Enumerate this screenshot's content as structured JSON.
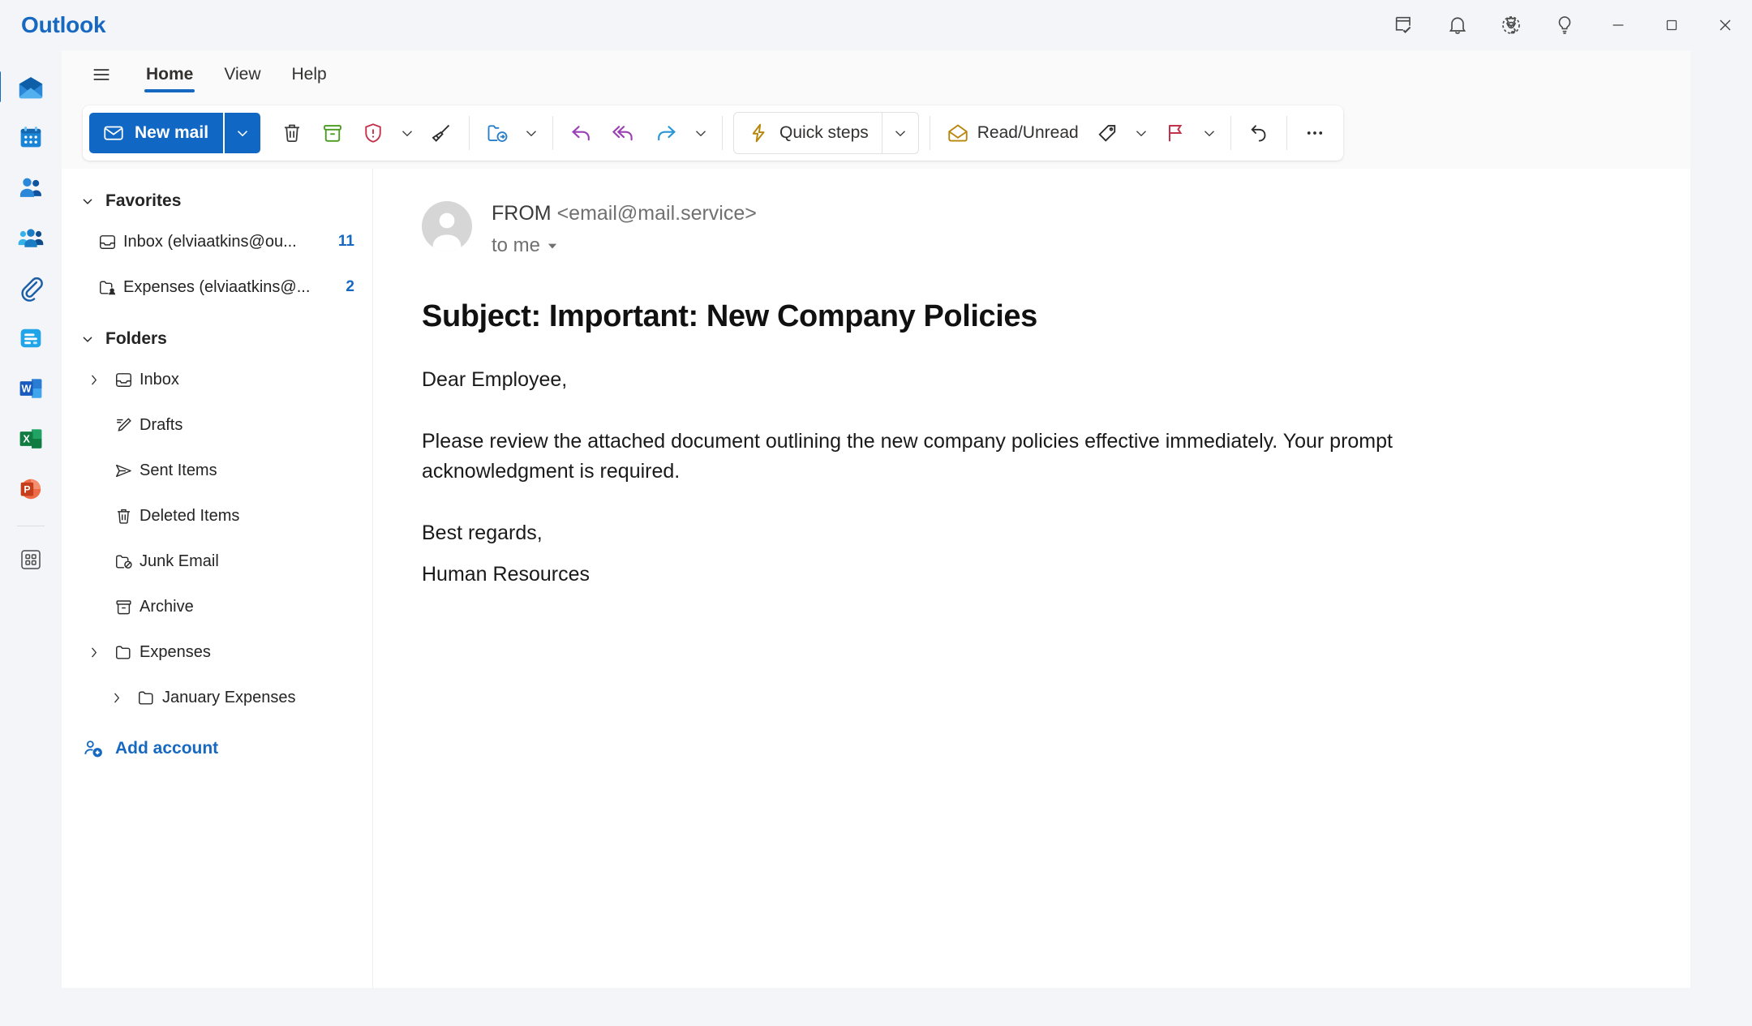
{
  "app": {
    "brand": "Outlook"
  },
  "titlebar": {
    "actions": [
      {
        "name": "new-note-icon",
        "label": "New note"
      },
      {
        "name": "notifications-bell-icon",
        "label": "Notifications"
      },
      {
        "name": "settings-gear-icon",
        "label": "Settings"
      },
      {
        "name": "tips-lightbulb-icon",
        "label": "Tips"
      }
    ],
    "window_controls": [
      {
        "name": "minimize-button",
        "label": "Minimize"
      },
      {
        "name": "maximize-button",
        "label": "Maximize"
      },
      {
        "name": "close-button",
        "label": "Close"
      }
    ]
  },
  "rail": {
    "items": [
      {
        "name": "rail-item-mail",
        "label": "Mail",
        "active": true
      },
      {
        "name": "rail-item-calendar",
        "label": "Calendar",
        "active": false
      },
      {
        "name": "rail-item-people",
        "label": "People",
        "active": false
      },
      {
        "name": "rail-item-groups",
        "label": "Groups",
        "active": false
      },
      {
        "name": "rail-item-attachments",
        "label": "Attachments",
        "active": false
      },
      {
        "name": "rail-item-bookings",
        "label": "Bookings",
        "active": false
      },
      {
        "name": "rail-item-word",
        "label": "Word",
        "active": false
      },
      {
        "name": "rail-item-excel",
        "label": "Excel",
        "active": false
      },
      {
        "name": "rail-item-powerpoint",
        "label": "PowerPoint",
        "active": false
      },
      {
        "name": "rail-item-apps",
        "label": "Apps",
        "active": false
      }
    ]
  },
  "ribbon": {
    "tabs": [
      {
        "label": "Home",
        "active": true
      },
      {
        "label": "View",
        "active": false
      },
      {
        "label": "Help",
        "active": false
      }
    ],
    "new_mail_label": "New mail",
    "quick_steps_label": "Quick steps",
    "read_unread_label": "Read/Unread",
    "buttons": [
      {
        "name": "delete-button",
        "label": "Delete"
      },
      {
        "name": "archive-button",
        "label": "Archive"
      },
      {
        "name": "report-junk-button",
        "label": "Report"
      },
      {
        "name": "sweep-button",
        "label": "Sweep"
      },
      {
        "name": "move-to-button",
        "label": "Move to"
      },
      {
        "name": "reply-button",
        "label": "Reply"
      },
      {
        "name": "reply-all-button",
        "label": "Reply all"
      },
      {
        "name": "forward-button",
        "label": "Forward"
      },
      {
        "name": "tag-button",
        "label": "Tag"
      },
      {
        "name": "flag-button",
        "label": "Flag"
      },
      {
        "name": "undo-button",
        "label": "Undo"
      },
      {
        "name": "more-options-button",
        "label": "More options"
      }
    ]
  },
  "sidebar": {
    "favorites": {
      "title": "Favorites",
      "items": [
        {
          "label": "Inbox (elviaatkins@ou...",
          "count": "11",
          "icon": "inbox-icon",
          "name": "sidebar-item-favorite-inbox"
        },
        {
          "label": "Expenses (elviaatkins@...",
          "count": "2",
          "icon": "shared-folder-icon",
          "name": "sidebar-item-favorite-expenses"
        }
      ]
    },
    "folders": {
      "title": "Folders",
      "items": [
        {
          "label": "Inbox",
          "count": "",
          "icon": "inbox-icon",
          "indent": 0,
          "twisty": true,
          "name": "sidebar-item-inbox"
        },
        {
          "label": "Drafts",
          "count": "",
          "icon": "drafts-pencil-icon",
          "indent": 0,
          "twisty": false,
          "name": "sidebar-item-drafts"
        },
        {
          "label": "Sent Items",
          "count": "",
          "icon": "sent-plane-icon",
          "indent": 0,
          "twisty": false,
          "name": "sidebar-item-sent-items"
        },
        {
          "label": "Deleted Items",
          "count": "",
          "icon": "trash-icon",
          "indent": 0,
          "twisty": false,
          "name": "sidebar-item-deleted-items"
        },
        {
          "label": "Junk Email",
          "count": "",
          "icon": "junk-folder-icon",
          "indent": 0,
          "twisty": false,
          "name": "sidebar-item-junk-email"
        },
        {
          "label": "Archive",
          "count": "",
          "icon": "archive-box-icon",
          "indent": 0,
          "twisty": false,
          "name": "sidebar-item-archive"
        },
        {
          "label": "Expenses",
          "count": "",
          "icon": "folder-icon",
          "indent": 0,
          "twisty": true,
          "name": "sidebar-item-expenses"
        },
        {
          "label": "January Expenses",
          "count": "",
          "icon": "folder-icon",
          "indent": 1,
          "twisty": true,
          "name": "sidebar-item-january-expenses"
        }
      ]
    },
    "add_account_label": "Add account"
  },
  "message": {
    "from_label": "FROM",
    "from_address": "<email@mail.service>",
    "to_label": "to me",
    "subject": "Subject: Important: New Company Policies",
    "greeting": "Dear Employee,",
    "paragraph": "Please review the attached document outlining the new company policies effective immediately. Your prompt acknowledgment is required.",
    "closing": "Best regards,",
    "signature": "Human Resources"
  },
  "colors": {
    "brand_blue": "#1668c1",
    "accent_button": "#1168c4",
    "archive_green": "#4a9c1f",
    "junk_red": "#c4314b",
    "reply_purple": "#9b3fb5",
    "forward_blue": "#2a95d5",
    "quick_steps_gold": "#b8860b",
    "flag_red": "#c4314b"
  }
}
